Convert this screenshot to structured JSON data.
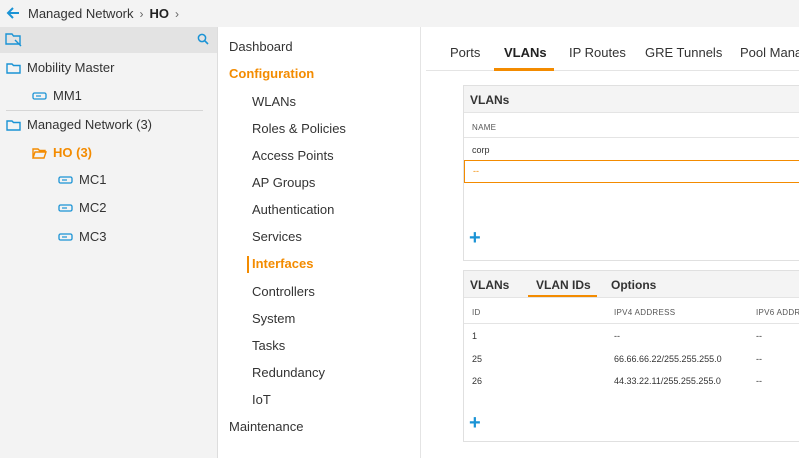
{
  "breadcrumb": {
    "root": "Managed Network",
    "separator": "›",
    "current": "HO"
  },
  "tree": {
    "items": [
      {
        "label": "Mobility Master",
        "icon": "folder-icon"
      },
      {
        "label": "MM1",
        "icon": "device-icon"
      },
      {
        "label": "Managed Network (3)",
        "icon": "folder-icon"
      },
      {
        "label": "HO (3)",
        "icon": "folder-open-icon"
      },
      {
        "label": "MC1",
        "icon": "device-icon"
      },
      {
        "label": "MC2",
        "icon": "device-icon"
      },
      {
        "label": "MC3",
        "icon": "device-icon"
      }
    ]
  },
  "nav": {
    "dashboard": "Dashboard",
    "configuration": "Configuration",
    "sub": [
      "WLANs",
      "Roles & Policies",
      "Access Points",
      "AP Groups",
      "Authentication",
      "Services",
      "Interfaces",
      "Controllers",
      "System",
      "Tasks",
      "Redundancy",
      "IoT"
    ],
    "maintenance": "Maintenance"
  },
  "tabs": [
    "Ports",
    "VLANs",
    "IP Routes",
    "GRE Tunnels",
    "Pool Mana"
  ],
  "vlans_panel": {
    "title": "VLANs",
    "column": "NAME",
    "rows": [
      "corp"
    ],
    "new_row_value": "--",
    "add_symbol": "+"
  },
  "vlan_ids_panel": {
    "subtabs": [
      "VLANs",
      "VLAN IDs",
      "Options"
    ],
    "columns": [
      "ID",
      "IPV4 ADDRESS",
      "IPV6 ADDR"
    ],
    "rows": [
      {
        "id": "1",
        "ipv4": "--",
        "ipv6": "--"
      },
      {
        "id": "25",
        "ipv4": "66.66.66.22/255.255.255.0",
        "ipv6": "--"
      },
      {
        "id": "26",
        "ipv4": "44.33.22.11/255.255.255.0",
        "ipv6": "--"
      }
    ],
    "add_symbol": "+"
  },
  "colors": {
    "accent": "#f38b00",
    "link": "#1a93d5"
  }
}
